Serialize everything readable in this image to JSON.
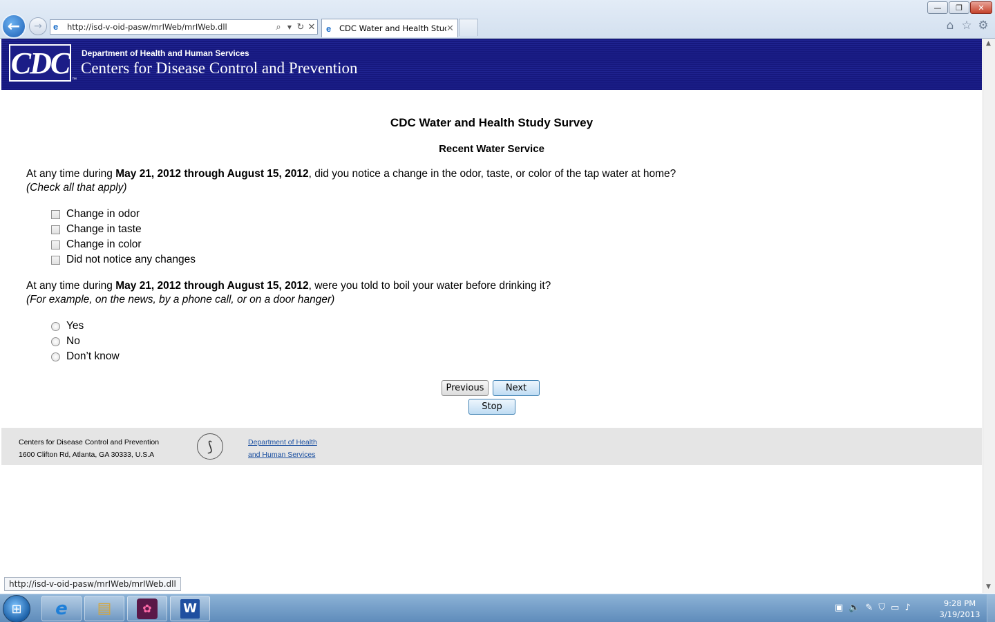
{
  "browser": {
    "url": "http://isd-v-oid-pasw/mrIWeb/mrIWeb.dll",
    "tab_title": "CDC Water and Health Study",
    "tab_close": "✕",
    "status_url": "http://isd-v-oid-pasw/mrIWeb/mrIWeb.dll",
    "window_buttons": {
      "minimize": "—",
      "restore": "❐",
      "close": "✕"
    },
    "icons": [
      "back-arrow-icon",
      "forward-arrow-icon",
      "search-icon",
      "refresh-icon",
      "stop-icon",
      "home-icon",
      "favorites-star-icon",
      "tools-gear-icon"
    ]
  },
  "header": {
    "logo_text": "CDC",
    "logo_tm": "™",
    "department": "Department of Health and Human Services",
    "agency": "Centers for Disease Control and Prevention"
  },
  "survey": {
    "title": "CDC Water and Health Study Survey",
    "section": "Recent Water Service",
    "q1": {
      "prefix": "At any time during ",
      "dates": "May 21, 2012 through August 15, 2012",
      "suffix": ", did you notice a change in the odor, taste, or color of the tap water at home?",
      "note": "(Check all that apply)",
      "options": [
        "Change in odor",
        "Change in taste",
        "Change in color",
        "Did not notice any changes"
      ]
    },
    "q2": {
      "prefix": "At any time during ",
      "dates": "May 21, 2012 through August 15, 2012",
      "suffix": ", were you told to boil your water before drinking it?",
      "note": "(For example, on the news, by a phone call, or on a door hanger)",
      "options": [
        "Yes",
        "No",
        "Don’t know"
      ]
    },
    "buttons": {
      "previous": "Previous",
      "next": "Next",
      "stop": "Stop"
    }
  },
  "footer": {
    "org_name": "Centers for Disease Control and Prevention",
    "address": "1600 Clifton Rd, Atlanta, GA 30333, U.S.A",
    "hhs_link_line1": "Department of Health",
    "hhs_link_line2": "and Human Services"
  },
  "taskbar": {
    "apps": [
      "internet-explorer",
      "windows-explorer",
      "app-3",
      "microsoft-word"
    ],
    "clock_time": "9:28 PM",
    "clock_date": "3/19/2013"
  }
}
